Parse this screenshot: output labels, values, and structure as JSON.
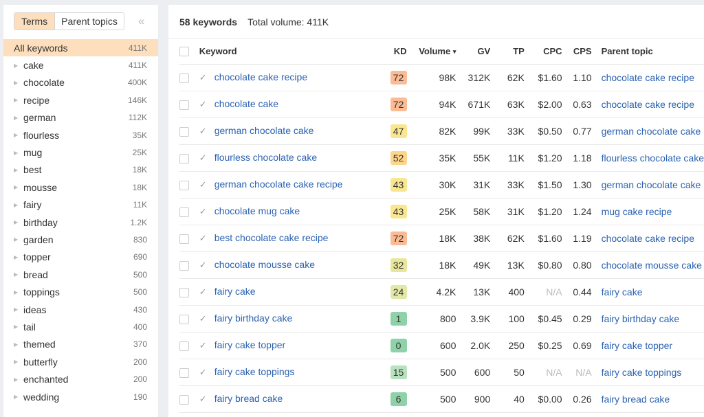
{
  "sidebar": {
    "tabs": [
      {
        "label": "Terms",
        "active": true
      },
      {
        "label": "Parent topics",
        "active": false
      }
    ],
    "collapse_icon": "«",
    "all": {
      "label": "All keywords",
      "count": "411K"
    },
    "items": [
      {
        "label": "cake",
        "count": "411K"
      },
      {
        "label": "chocolate",
        "count": "400K"
      },
      {
        "label": "recipe",
        "count": "146K"
      },
      {
        "label": "german",
        "count": "112K"
      },
      {
        "label": "flourless",
        "count": "35K"
      },
      {
        "label": "mug",
        "count": "25K"
      },
      {
        "label": "best",
        "count": "18K"
      },
      {
        "label": "mousse",
        "count": "18K"
      },
      {
        "label": "fairy",
        "count": "11K"
      },
      {
        "label": "birthday",
        "count": "1.2K"
      },
      {
        "label": "garden",
        "count": "830"
      },
      {
        "label": "topper",
        "count": "690"
      },
      {
        "label": "bread",
        "count": "500"
      },
      {
        "label": "toppings",
        "count": "500"
      },
      {
        "label": "ideas",
        "count": "430"
      },
      {
        "label": "tail",
        "count": "400"
      },
      {
        "label": "themed",
        "count": "370"
      },
      {
        "label": "butterfly",
        "count": "200"
      },
      {
        "label": "enchanted",
        "count": "200"
      },
      {
        "label": "wedding",
        "count": "190"
      }
    ]
  },
  "summary": {
    "keywords": "58 keywords",
    "total_volume": "Total volume: 411K"
  },
  "table": {
    "headers": {
      "keyword": "Keyword",
      "kd": "KD",
      "volume": "Volume",
      "sort_icon": "▾",
      "gv": "GV",
      "tp": "TP",
      "cpc": "CPC",
      "cps": "CPS",
      "parent": "Parent topic"
    },
    "check_icon": "✓",
    "kd_colors": {
      "high": "#fbbb94",
      "orange": "#fdd68b",
      "yellow": "#fae690",
      "lime": "#e3e8a1",
      "lightgreen": "#b7e2bd",
      "green": "#8fd1a9"
    },
    "rows": [
      {
        "keyword": "chocolate cake recipe",
        "kd": "72",
        "kd_color": "#fbbb94",
        "volume": "98K",
        "gv": "312K",
        "tp": "62K",
        "cpc": "$1.60",
        "cps": "1.10",
        "parent": "chocolate cake recipe"
      },
      {
        "keyword": "chocolate cake",
        "kd": "72",
        "kd_color": "#fbbb94",
        "volume": "94K",
        "gv": "671K",
        "tp": "63K",
        "cpc": "$2.00",
        "cps": "0.63",
        "parent": "chocolate cake recipe"
      },
      {
        "keyword": "german chocolate cake",
        "kd": "47",
        "kd_color": "#fae690",
        "volume": "82K",
        "gv": "99K",
        "tp": "33K",
        "cpc": "$0.50",
        "cps": "0.77",
        "parent": "german chocolate cake"
      },
      {
        "keyword": "flourless chocolate cake",
        "kd": "52",
        "kd_color": "#fdd68b",
        "volume": "35K",
        "gv": "55K",
        "tp": "11K",
        "cpc": "$1.20",
        "cps": "1.18",
        "parent": "flourless chocolate cake"
      },
      {
        "keyword": "german chocolate cake recipe",
        "kd": "43",
        "kd_color": "#fae690",
        "volume": "30K",
        "gv": "31K",
        "tp": "33K",
        "cpc": "$1.50",
        "cps": "1.30",
        "parent": "german chocolate cake"
      },
      {
        "keyword": "chocolate mug cake",
        "kd": "43",
        "kd_color": "#fae690",
        "volume": "25K",
        "gv": "58K",
        "tp": "31K",
        "cpc": "$1.20",
        "cps": "1.24",
        "parent": "mug cake recipe"
      },
      {
        "keyword": "best chocolate cake recipe",
        "kd": "72",
        "kd_color": "#fbbb94",
        "volume": "18K",
        "gv": "38K",
        "tp": "62K",
        "cpc": "$1.60",
        "cps": "1.19",
        "parent": "chocolate cake recipe"
      },
      {
        "keyword": "chocolate mousse cake",
        "kd": "32",
        "kd_color": "#e8e69a",
        "volume": "18K",
        "gv": "49K",
        "tp": "13K",
        "cpc": "$0.80",
        "cps": "0.80",
        "parent": "chocolate mousse cake"
      },
      {
        "keyword": "fairy cake",
        "kd": "24",
        "kd_color": "#e3e8a8",
        "volume": "4.2K",
        "gv": "13K",
        "tp": "400",
        "cpc": "N/A",
        "cps": "0.44",
        "parent": "fairy cake"
      },
      {
        "keyword": "fairy birthday cake",
        "kd": "1",
        "kd_color": "#8fd1a9",
        "volume": "800",
        "gv": "3.9K",
        "tp": "100",
        "cpc": "$0.45",
        "cps": "0.29",
        "parent": "fairy birthday cake"
      },
      {
        "keyword": "fairy cake topper",
        "kd": "0",
        "kd_color": "#8fd1a9",
        "volume": "600",
        "gv": "2.0K",
        "tp": "250",
        "cpc": "$0.25",
        "cps": "0.69",
        "parent": "fairy cake topper"
      },
      {
        "keyword": "fairy cake toppings",
        "kd": "15",
        "kd_color": "#b7e2bd",
        "volume": "500",
        "gv": "600",
        "tp": "50",
        "cpc": "N/A",
        "cps": "N/A",
        "parent": "fairy cake toppings"
      },
      {
        "keyword": "fairy bread cake",
        "kd": "6",
        "kd_color": "#8fd1a9",
        "volume": "500",
        "gv": "900",
        "tp": "40",
        "cpc": "$0.00",
        "cps": "0.26",
        "parent": "fairy bread cake"
      }
    ]
  }
}
